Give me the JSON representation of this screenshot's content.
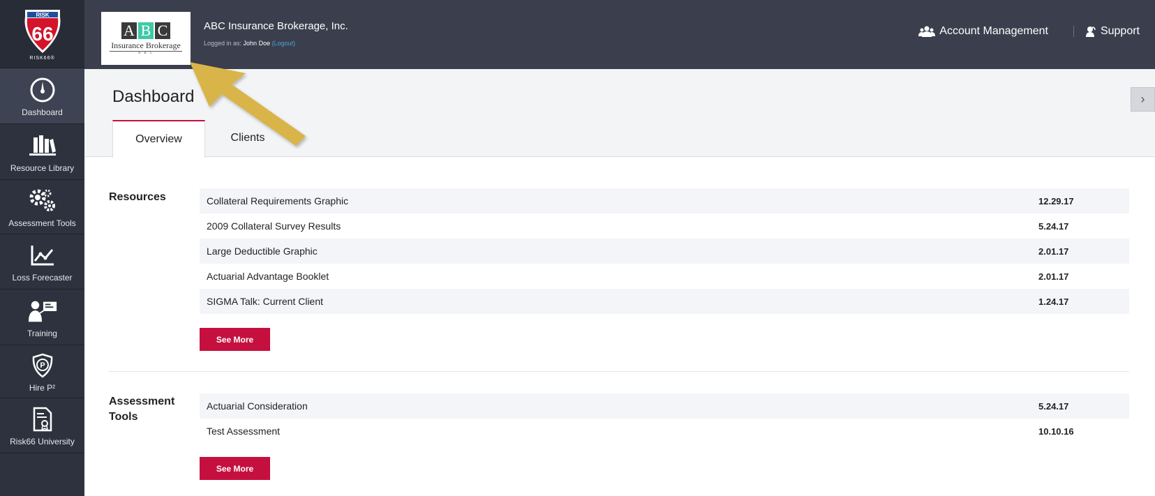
{
  "sidebar": {
    "logo": {
      "top": "RISK",
      "number": "66",
      "sub": "RISK66®"
    },
    "items": [
      {
        "label": "Dashboard",
        "icon": "gauge-icon",
        "active": true
      },
      {
        "label": "Resource Library",
        "icon": "books-icon"
      },
      {
        "label": "Assessment Tools",
        "icon": "gears-icon"
      },
      {
        "label": "Loss Forecaster",
        "icon": "line-chart-icon"
      },
      {
        "label": "Training",
        "icon": "presenter-icon"
      },
      {
        "label": "Hire P²",
        "icon": "shield-p-icon"
      },
      {
        "label": "Risk66 University",
        "icon": "certificate-doc-icon"
      }
    ]
  },
  "header": {
    "brand": {
      "letters": [
        "A",
        "B",
        "C"
      ],
      "name": "Insurance Brokerage",
      "sub": "A B C"
    },
    "company": "ABC Insurance Brokerage, Inc.",
    "logged_in_prefix": "Logged in as: ",
    "user": "John Doe",
    "logout": "(Logout)",
    "account_management": "Account Management",
    "support": "Support"
  },
  "page": {
    "title": "Dashboard",
    "tabs": [
      {
        "label": "Overview",
        "active": true
      },
      {
        "label": "Clients"
      }
    ]
  },
  "resources": {
    "label": "Resources",
    "items": [
      {
        "name": "Collateral Requirements Graphic",
        "date": "12.29.17"
      },
      {
        "name": "2009 Collateral Survey Results",
        "date": "5.24.17"
      },
      {
        "name": "Large Deductible Graphic",
        "date": "2.01.17"
      },
      {
        "name": "Actuarial Advantage Booklet",
        "date": "2.01.17"
      },
      {
        "name": "SIGMA Talk: Current Client",
        "date": "1.24.17"
      }
    ],
    "see_more": "See More"
  },
  "assessment_tools": {
    "label": "Assessment Tools",
    "items": [
      {
        "name": "Actuarial Consideration",
        "date": "5.24.17"
      },
      {
        "name": "Test Assessment",
        "date": "10.10.16"
      }
    ],
    "see_more": "See More"
  },
  "colors": {
    "sidebar": "#2d323e",
    "header": "#3b3f4d",
    "accent": "#c5103f",
    "arrow": "#d9b44a"
  }
}
